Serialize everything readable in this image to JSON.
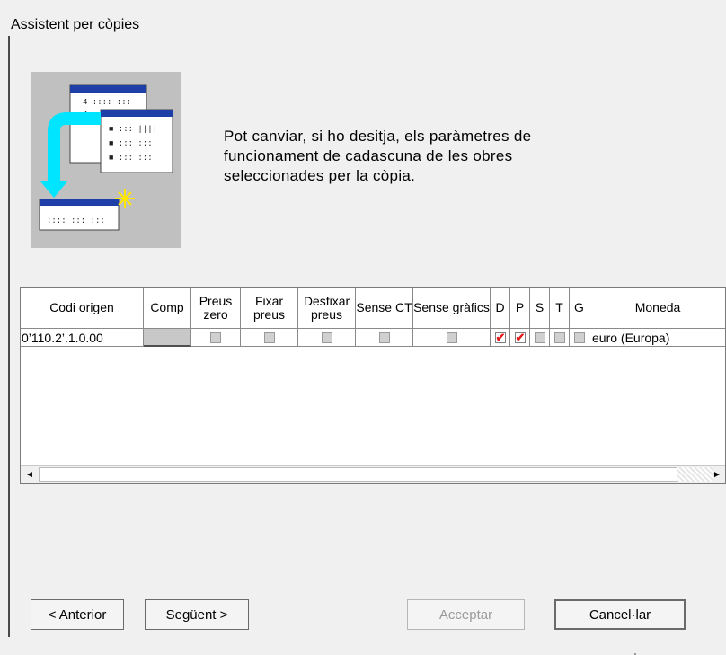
{
  "window": {
    "title": "Assistent per còpies"
  },
  "intro_text": "Pot canviar, si ho desitja, els paràmetres de funcionament de cadascuna de les obres seleccionades per la còpia.",
  "table": {
    "columns": [
      "Codi origen",
      "Comp",
      "Preus zero",
      "Fixar preus",
      "Desfixar preus",
      "Sense CT",
      "Sense gràfics",
      "D",
      "P",
      "S",
      "T",
      "G",
      "Moneda"
    ],
    "row": {
      "codi_origen": "0’110.2’.1.0.00",
      "comp": "",
      "preus_zero": false,
      "fixar_preus": false,
      "desfixar_preus": false,
      "sense_ct": false,
      "sense_grafics": false,
      "d": true,
      "p": true,
      "s": false,
      "t": false,
      "g": false,
      "moneda": "euro (Europa)"
    }
  },
  "scrollbar": {
    "left_arrow": "◄",
    "right_arrow": "►"
  },
  "buttons": {
    "anterior": "< Anterior",
    "seguent": "Següent >",
    "acceptar": "Acceptar",
    "cancel": "Cancel·lar"
  },
  "colors": {
    "check_mark": "#e21b1b",
    "illustration_bg": "#c0c0c0",
    "arrow_cyan": "#00e5ff"
  }
}
